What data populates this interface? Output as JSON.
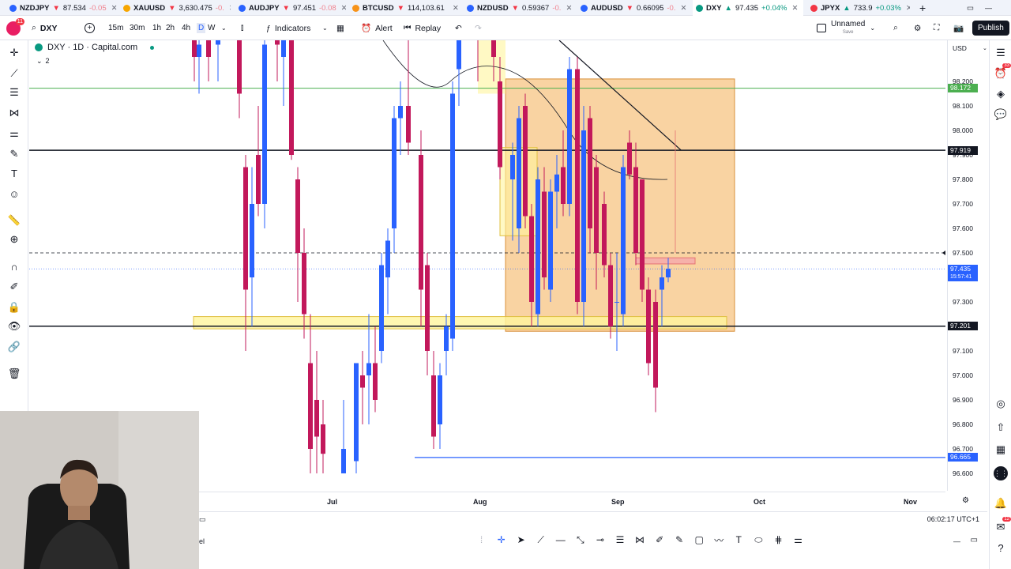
{
  "tabs": [
    {
      "symbol": "NZDJPY",
      "price": "87.534",
      "change": "-0.05",
      "dir": "down",
      "color": "#2962ff"
    },
    {
      "symbol": "XAUUSD",
      "price": "3,630.475",
      "change": "-0.",
      "dir": "down",
      "color": "#f7a600"
    },
    {
      "symbol": "AUDJPY",
      "price": "97.451",
      "change": "-0.08",
      "dir": "down",
      "color": "#2962ff"
    },
    {
      "symbol": "BTCUSD",
      "price": "114,103.61",
      "change": "",
      "dir": "down",
      "color": "#f7931a"
    },
    {
      "symbol": "NZDUSD",
      "price": "0.59367",
      "change": "-0.",
      "dir": "down",
      "color": "#2962ff"
    },
    {
      "symbol": "AUDUSD",
      "price": "0.66095",
      "change": "-0.",
      "dir": "down",
      "color": "#2962ff"
    },
    {
      "symbol": "DXY",
      "price": "97.435",
      "change": "+0.04%",
      "dir": "up",
      "color": "#089981"
    },
    {
      "symbol": "JPYX",
      "price": "733.9",
      "change": "+0.03%",
      "dir": "up",
      "color": "#f23645"
    }
  ],
  "tab_new": "+",
  "toolbar": {
    "avatar_badge": "11",
    "symbol": "DXY",
    "timeframes": [
      "15m",
      "30m",
      "1h",
      "2h",
      "4h",
      "D",
      "W"
    ],
    "indicators_label": "Indicators",
    "alert_label": "Alert",
    "replay_label": "Replay",
    "layout_name": "Unnamed",
    "layout_sub": "Save",
    "publish_label": "Publish"
  },
  "legend": {
    "title": "DXY · 1D · Capital.com",
    "count": "2"
  },
  "price_axis": {
    "currency": "USD",
    "ticks": [
      "98.200",
      "98.100",
      "98.000",
      "97.900",
      "97.800",
      "97.700",
      "97.600",
      "97.500",
      "97.300",
      "97.100",
      "97.000",
      "96.900",
      "96.800",
      "96.700",
      "96.600"
    ],
    "badges": [
      {
        "value": "98.172",
        "color": "#4caf50"
      },
      {
        "value": "97.919",
        "color": "#131722"
      },
      {
        "value": "97.435",
        "color": "#2962ff"
      },
      {
        "value": "97.201",
        "color": "#131722"
      },
      {
        "value": "96.665",
        "color": "#2962ff"
      }
    ],
    "countdown": "15:57:41"
  },
  "time_axis": [
    "Jul",
    "Aug",
    "Sep",
    "Oct",
    "Nov"
  ],
  "clock": "06:02:17 UTC+1",
  "bottom_left_text": "el",
  "right_badges": {
    "alerts": "33",
    "notifications": "12"
  },
  "colors": {
    "up": "#2962ff",
    "down": "#c2185b",
    "zone": "#f5b060",
    "yellow": "#fff176"
  }
}
